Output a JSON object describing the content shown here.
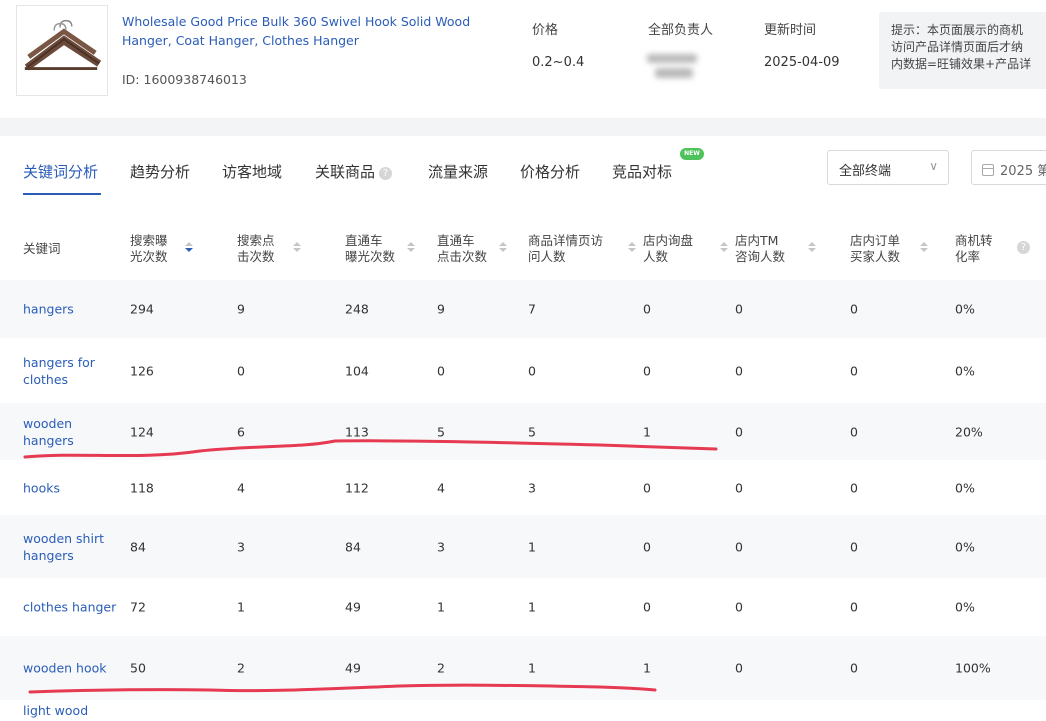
{
  "product": {
    "title": "Wholesale Good Price Bulk 360 Swivel Hook Solid Wood Hanger, Coat Hanger, Clothes Hanger",
    "id_text": "ID: 1600938746013"
  },
  "meta": {
    "price_label": "价格",
    "price_value": "0.2~0.4",
    "owner_label": "全部负责人",
    "updated_label": "更新时间",
    "updated_value": "2025-04-09"
  },
  "tip": {
    "line1": "提示：本页面展示的商机",
    "line2": "访问产品详情页面后才纳",
    "line3": "内数据=旺铺效果+产品详"
  },
  "tabs": [
    {
      "label": "关键词分析"
    },
    {
      "label": "趋势分析"
    },
    {
      "label": "访客地域"
    },
    {
      "label": "关联商品"
    },
    {
      "label": "流量来源"
    },
    {
      "label": "价格分析"
    },
    {
      "label": "竞品对标"
    }
  ],
  "new_badge": "NEW",
  "help_glyph": "?",
  "terminal_select": {
    "value": "全部终端"
  },
  "date_picker": {
    "value": "2025 第"
  },
  "columns": {
    "c0": {
      "l1": "关键词",
      "l2": ""
    },
    "c1": {
      "l1": "搜索曝",
      "l2": "光次数"
    },
    "c2": {
      "l1": "搜索点",
      "l2": "击次数"
    },
    "c3": {
      "l1": "直通车",
      "l2": "曝光次数"
    },
    "c4": {
      "l1": "直通车",
      "l2": "点击次数"
    },
    "c5": {
      "l1": "商品详情页访",
      "l2": "问人数"
    },
    "c6": {
      "l1": "店内询盘",
      "l2": "人数"
    },
    "c7": {
      "l1": "店内TM",
      "l2": "咨询人数"
    },
    "c8": {
      "l1": "店内订单",
      "l2": "买家人数"
    },
    "c9": {
      "l1": "商机转",
      "l2": "化率"
    }
  },
  "rows": [
    {
      "keyword": "hangers",
      "v1": "294",
      "v2": "9",
      "v3": "248",
      "v4": "9",
      "v5": "7",
      "v6": "0",
      "v7": "0",
      "v8": "0",
      "v9": "0%"
    },
    {
      "keyword": "hangers for clothes",
      "v1": "126",
      "v2": "0",
      "v3": "104",
      "v4": "0",
      "v5": "0",
      "v6": "0",
      "v7": "0",
      "v8": "0",
      "v9": "0%"
    },
    {
      "keyword": "wooden hangers",
      "v1": "124",
      "v2": "6",
      "v3": "113",
      "v4": "5",
      "v5": "5",
      "v6": "1",
      "v7": "0",
      "v8": "0",
      "v9": "20%"
    },
    {
      "keyword": "hooks",
      "v1": "118",
      "v2": "4",
      "v3": "112",
      "v4": "4",
      "v5": "3",
      "v6": "0",
      "v7": "0",
      "v8": "0",
      "v9": "0%"
    },
    {
      "keyword": "wooden shirt hangers",
      "v1": "84",
      "v2": "3",
      "v3": "84",
      "v4": "3",
      "v5": "1",
      "v6": "0",
      "v7": "0",
      "v8": "0",
      "v9": "0%"
    },
    {
      "keyword": "clothes hanger",
      "v1": "72",
      "v2": "1",
      "v3": "49",
      "v4": "1",
      "v5": "1",
      "v6": "0",
      "v7": "0",
      "v8": "0",
      "v9": "0%"
    },
    {
      "keyword": "wooden hook",
      "v1": "50",
      "v2": "2",
      "v3": "49",
      "v4": "2",
      "v5": "1",
      "v6": "1",
      "v7": "0",
      "v8": "0",
      "v9": "100%"
    },
    {
      "keyword": "light wood",
      "v1": "",
      "v2": "",
      "v3": "",
      "v4": "",
      "v5": "",
      "v6": "",
      "v7": "",
      "v8": "",
      "v9": ""
    }
  ],
  "colors": {
    "accent": "#2a5db8",
    "highlight_stroke": "#e63a52",
    "row_shade": "#f7f8fa"
  }
}
